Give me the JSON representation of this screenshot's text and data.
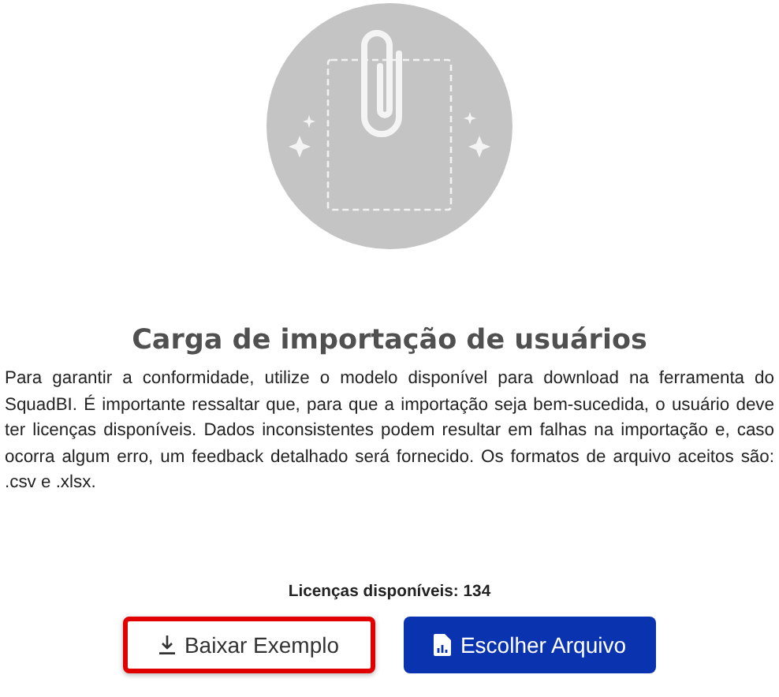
{
  "title": "Carga de importação de usuários",
  "description": "Para garantir a conformidade, utilize o modelo disponível para download na ferramenta do SquadBI. É importante ressaltar que, para que a importação seja bem-sucedida, o usuário deve ter licenças disponíveis. Dados inconsistentes podem resultar em falhas na importação e, caso ocorra algum erro, um feedback detalhado será fornecido. Os formatos de arquivo aceitos são: .csv e .xlsx.",
  "licenses": "Licenças disponíveis: 134",
  "buttons": [
    {
      "label": "Baixar Exemplo",
      "kind": "download",
      "highlighted": true
    },
    {
      "label": "Escolher Arquivo",
      "kind": "upload",
      "highlighted": false
    }
  ]
}
